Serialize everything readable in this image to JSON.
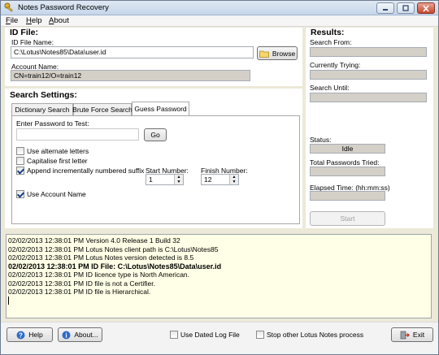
{
  "window": {
    "title": "Notes Password Recovery"
  },
  "menu": {
    "items": [
      {
        "accel": "F",
        "rest": "ile"
      },
      {
        "accel": "H",
        "rest": "elp"
      },
      {
        "accel": "A",
        "rest": "bout"
      }
    ]
  },
  "id_file": {
    "header": "ID File:",
    "file_name_label": "ID File Name:",
    "file_name_value": "C:\\Lotus\\Notes85\\Data\\user.id",
    "browse_label": "Browse",
    "account_name_label": "Account Name:",
    "account_name_value": "CN=train12/O=train12"
  },
  "search_settings": {
    "header": "Search Settings:",
    "tabs": [
      "Dictionary Search",
      "Brute Force Search",
      "Guess Password"
    ],
    "active_tab": "Guess Password",
    "enter_password_label": "Enter Password to Test:",
    "password_value": "",
    "go_label": "Go",
    "options": [
      {
        "label": "Use alternate letters",
        "checked": false
      },
      {
        "label": "Capitalise first letter",
        "checked": false
      },
      {
        "label": "Append incrementally numbered suffix",
        "checked": true
      },
      {
        "label": "Use Account Name",
        "checked": true
      }
    ],
    "start_number_label": "Start Number:",
    "start_number_value": "1",
    "finish_number_label": "Finish Number:",
    "finish_number_value": "12"
  },
  "results": {
    "header": "Results:",
    "search_from_label": "Search From:",
    "search_from_value": "",
    "currently_trying_label": "Currently Trying:",
    "currently_trying_value": "",
    "search_until_label": "Search Until:",
    "search_until_value": "",
    "status_label": "Status:",
    "status_value": "Idle",
    "total_tried_label": "Total Passwords Tried:",
    "total_tried_value": "",
    "elapsed_label": "Elapsed Time: (hh:mm:ss)",
    "elapsed_value": "",
    "start_label": "Start"
  },
  "log": {
    "lines": [
      {
        "text": "02/02/2013 12:38:01 PM Version 4.0 Release 1 Build 32",
        "bold": false
      },
      {
        "text": "02/02/2013 12:38:01 PM Lotus Notes client path is C:\\Lotus\\Notes85",
        "bold": false
      },
      {
        "text": "02/02/2013 12:38:01 PM Lotus Notes version detected is 8.5",
        "bold": false
      },
      {
        "text": "02/02/2013 12:38:01 PM ID File: C:\\Lotus\\Notes85\\Data\\user.id",
        "bold": true
      },
      {
        "text": "02/02/2013 12:38:01 PM ID licence type is North American.",
        "bold": false
      },
      {
        "text": "02/02/2013 12:38:01 PM ID file is not a Certifier.",
        "bold": false
      },
      {
        "text": "02/02/2013 12:38:01 PM ID file is Hierarchical.",
        "bold": false
      }
    ]
  },
  "bottom": {
    "help_label": "Help",
    "about_label": "About...",
    "dated_log_label": "Use Dated Log File",
    "dated_log_checked": false,
    "stop_process_label": "Stop other Lotus Notes process",
    "stop_process_checked": false,
    "exit_label": "Exit"
  },
  "colors": {
    "log_bg": "#ffffe7",
    "window_bg": "#ece9d8",
    "readonly_bg": "#d4d0c8"
  },
  "icons": [
    "key-icon",
    "minimize-icon",
    "maximize-icon",
    "close-icon",
    "folder-icon",
    "help-icon",
    "info-icon",
    "exit-icon"
  ]
}
